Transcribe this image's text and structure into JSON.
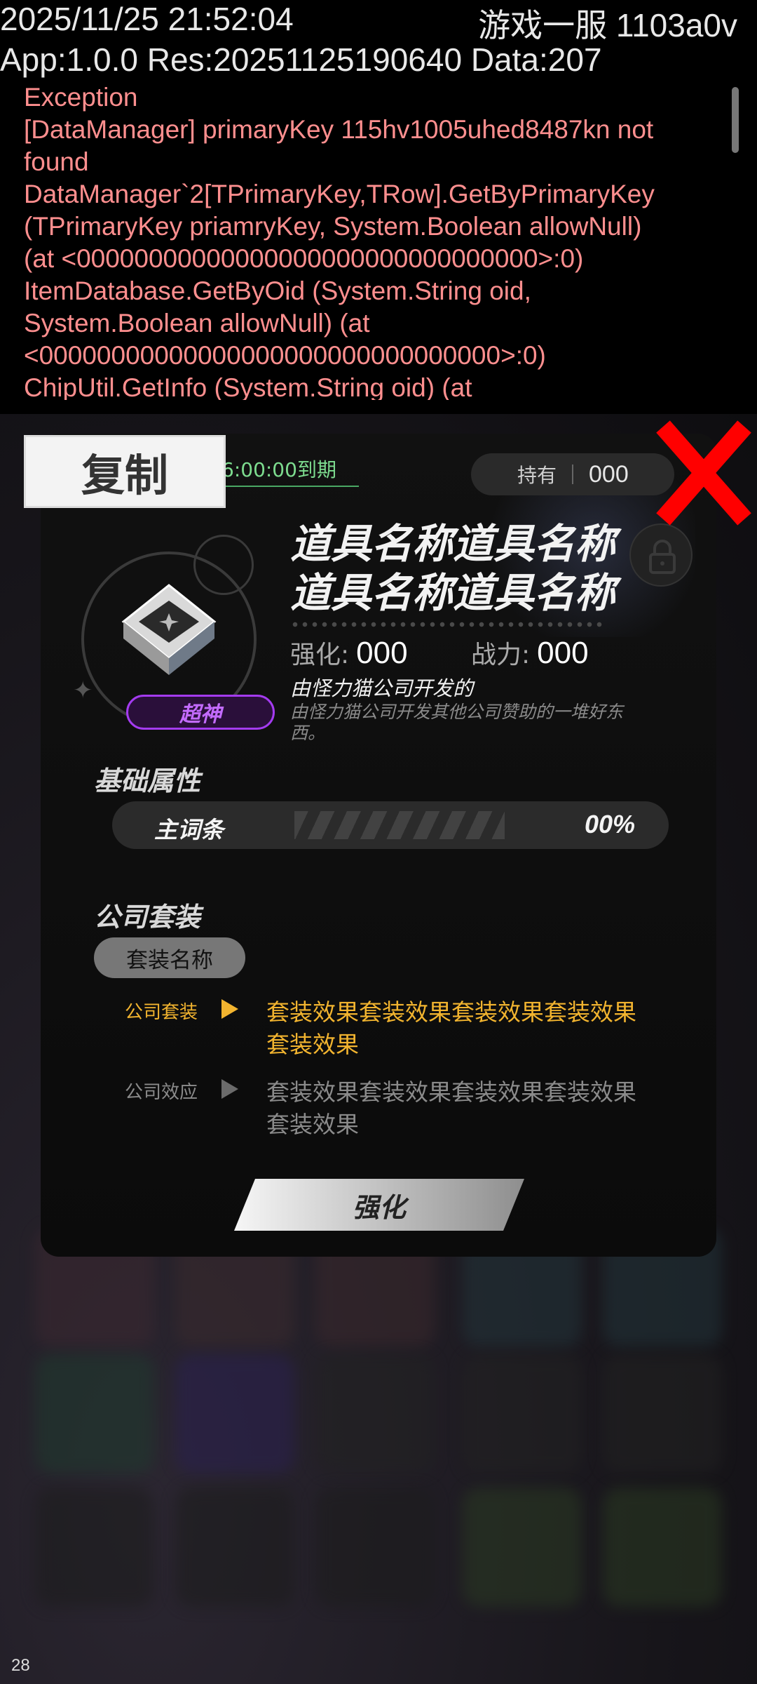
{
  "debug": {
    "timestamp": "2025/11/25 21:52:04",
    "server": "游戏一服 1103a0v",
    "version": "App:1.0.0 Res:20251125190640 Data:207",
    "exception_lines": [
      "Exception",
      "[DataManager] primaryKey 115hv1005uhed8487kn not",
      "found",
      "DataManager`2[TPrimaryKey,TRow].GetByPrimaryKey",
      "(TPrimaryKey priamryKey, System.Boolean allowNull)",
      "(at <00000000000000000000000000000000>:0)",
      "ItemDatabase.GetByOid (System.String oid,",
      "System.Boolean allowNull) (at",
      "<00000000000000000000000000000000>:0)",
      "ChipUtil.GetInfo (System.String oid) (at"
    ]
  },
  "dialog": {
    "copy_label": "复制",
    "expiry": "6:00:00到期",
    "hold_label": "持有",
    "hold_value": "000",
    "item_name": "道具名称道具名称道具名称道具名称",
    "rarity": "超神",
    "strength_label": "强化:",
    "strength_value": "000",
    "power_label": "战力:",
    "power_value": "000",
    "maker": "由怪力猫公司开发的",
    "description": "由怪力猫公司开发其他公司赞助的一堆好东西。",
    "base_attr_title": "基础属性",
    "main_attr_name": "主词条",
    "main_attr_value": "00%",
    "suit_title": "公司套装",
    "suit_name": "套装名称",
    "effects": [
      {
        "label": "公司套装",
        "text": "套装效果套装效果套装效果套装效果套装效果",
        "color": "#f2b42f"
      },
      {
        "label": "公司效应",
        "text": "套装效果套装效果套装效果套装效果套装效果",
        "color": "#8b8b8b"
      }
    ],
    "enhance_label": "强化"
  },
  "fps": "28",
  "icons": [
    "close-icon",
    "lock-icon",
    "item-gem-icon",
    "sparkle-icon"
  ]
}
